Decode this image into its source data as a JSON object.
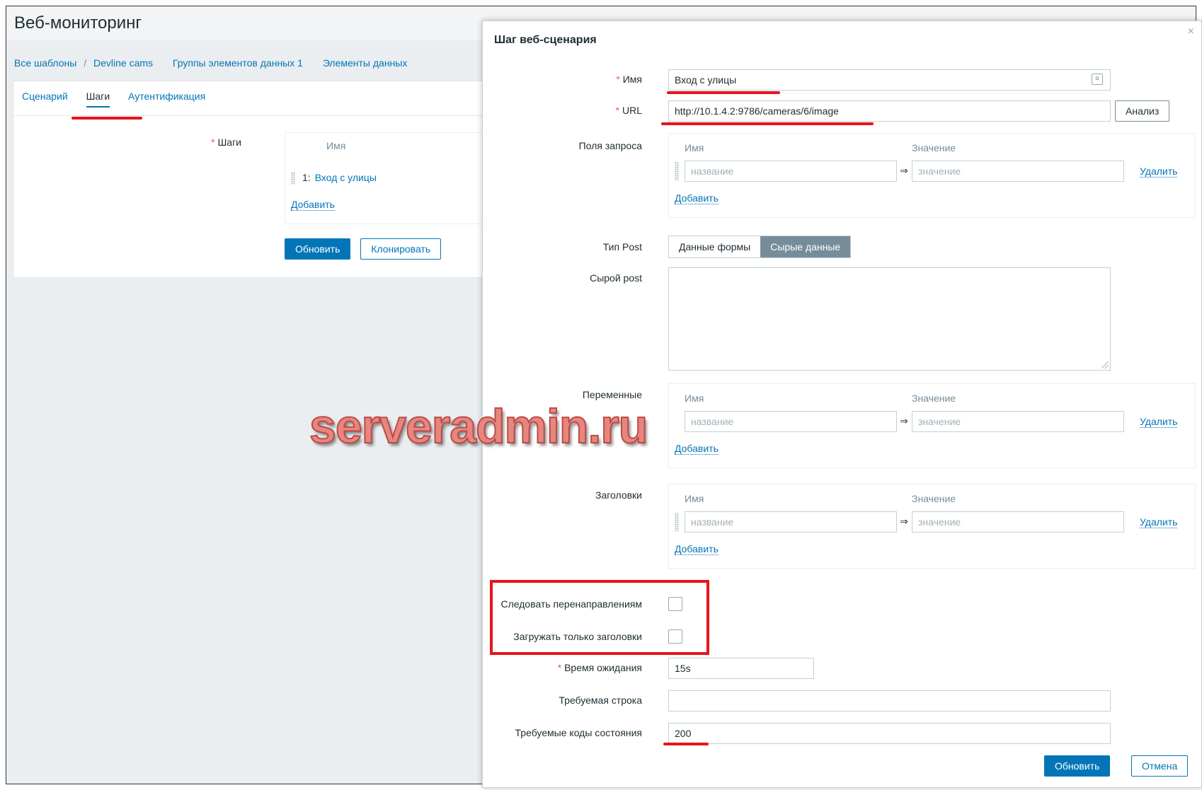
{
  "page": {
    "title": "Веб-мониторинг",
    "breadcrumb": {
      "all_templates": "Все шаблоны",
      "separator": "/",
      "template": "Devline cams",
      "item_groups": "Группы элементов данных 1",
      "items": "Элементы данных"
    },
    "tabs": [
      "Сценарий",
      "Шаги",
      "Аутентификация"
    ],
    "steps_label": "Шаги",
    "steps_column_name": "Имя",
    "steps": [
      {
        "num": "1:",
        "name": "Вход с улицы"
      }
    ],
    "add_label": "Добавить",
    "buttons": {
      "update": "Обновить",
      "clone": "Клонировать"
    }
  },
  "modal": {
    "title": "Шаг веб-сценария",
    "close": "×",
    "name_label": "Имя",
    "name_value": "Вход с улицы",
    "url_label": "URL",
    "url_value": "http://10.1.4.2:9786/cameras/6/image",
    "parse_button": "Анализ",
    "query_fields_label": "Поля запроса",
    "col_name": "Имя",
    "col_value": "Значение",
    "name_placeholder": "название",
    "value_placeholder": "значение",
    "arrow": "⇒",
    "remove_label": "Удалить",
    "add_label": "Добавить",
    "post_type_label": "Тип Post",
    "post_type_options": [
      "Данные формы",
      "Сырые данные"
    ],
    "post_type_selected": "Сырые данные",
    "raw_post_label": "Сырой post",
    "variables_label": "Переменные",
    "headers_label": "Заголовки",
    "follow_redirects_label": "Следовать перенаправлениям",
    "follow_redirects_checked": false,
    "retrieve_headers_label": "Загружать только заголовки",
    "retrieve_headers_checked": false,
    "timeout_label": "Время ожидания",
    "timeout_value": "15s",
    "required_string_label": "Требуемая строка",
    "required_string_value": "",
    "status_codes_label": "Требуемые коды состояния",
    "status_codes_value": "200",
    "update_button": "Обновить",
    "cancel_button": "Отмена",
    "required_mark": "*"
  },
  "watermark": "serveradmin.ru",
  "colors": {
    "accent": "#0275b8",
    "required": "#e45959",
    "annotation": "#e8141c",
    "segment_active": "#768d99"
  }
}
